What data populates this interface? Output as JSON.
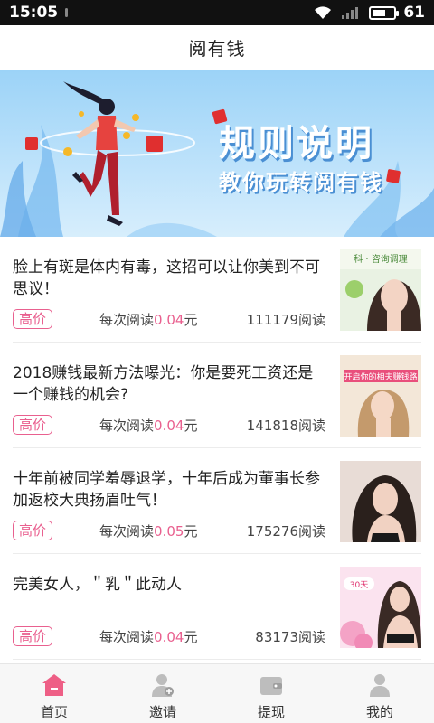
{
  "status_bar": {
    "time": "15:05",
    "battery": "61",
    "battery_level": 0.61
  },
  "header": {
    "title": "阅有钱"
  },
  "banner": {
    "title": "规则说明",
    "subtitle": "教你玩转阅有钱"
  },
  "articles": [
    {
      "title": "脸上有斑是体内有毒，这招可以让你美到不可思议！",
      "tag": "高价",
      "rate_prefix": "每次阅读",
      "rate_value": "0.04",
      "rate_unit": "元",
      "reads": "111179阅读",
      "thumb_text": "科 · 咨询调理"
    },
    {
      "title": "2018赚钱最新方法曝光：你是要死工资还是一个赚钱的机会?",
      "tag": "高价",
      "rate_prefix": "每次阅读",
      "rate_value": "0.04",
      "rate_unit": "元",
      "reads": "141818阅读",
      "thumb_text": "开启你的相夫赚钱路"
    },
    {
      "title": "十年前被同学羞辱退学，十年后成为董事长参加返校大典扬眉吐气！",
      "tag": "高价",
      "rate_prefix": "每次阅读",
      "rate_value": "0.05",
      "rate_unit": "元",
      "reads": "175276阅读",
      "thumb_text": ""
    },
    {
      "title": "完美女人，＂乳＂此动人",
      "tag": "高价",
      "rate_prefix": "每次阅读",
      "rate_value": "0.04",
      "rate_unit": "元",
      "reads": "83173阅读",
      "thumb_text": "30天"
    }
  ],
  "bottom_nav": [
    {
      "label": "首页",
      "icon": "home-icon",
      "active": true
    },
    {
      "label": "邀请",
      "icon": "invite-user-icon",
      "active": false
    },
    {
      "label": "提现",
      "icon": "wallet-icon",
      "active": false
    },
    {
      "label": "我的",
      "icon": "profile-icon",
      "active": false
    }
  ],
  "colors": {
    "accent": "#e9608f",
    "banner_bg": "#9cd3f7",
    "active_icon": "#ee5f86",
    "inactive_icon": "#bdbdbd"
  }
}
